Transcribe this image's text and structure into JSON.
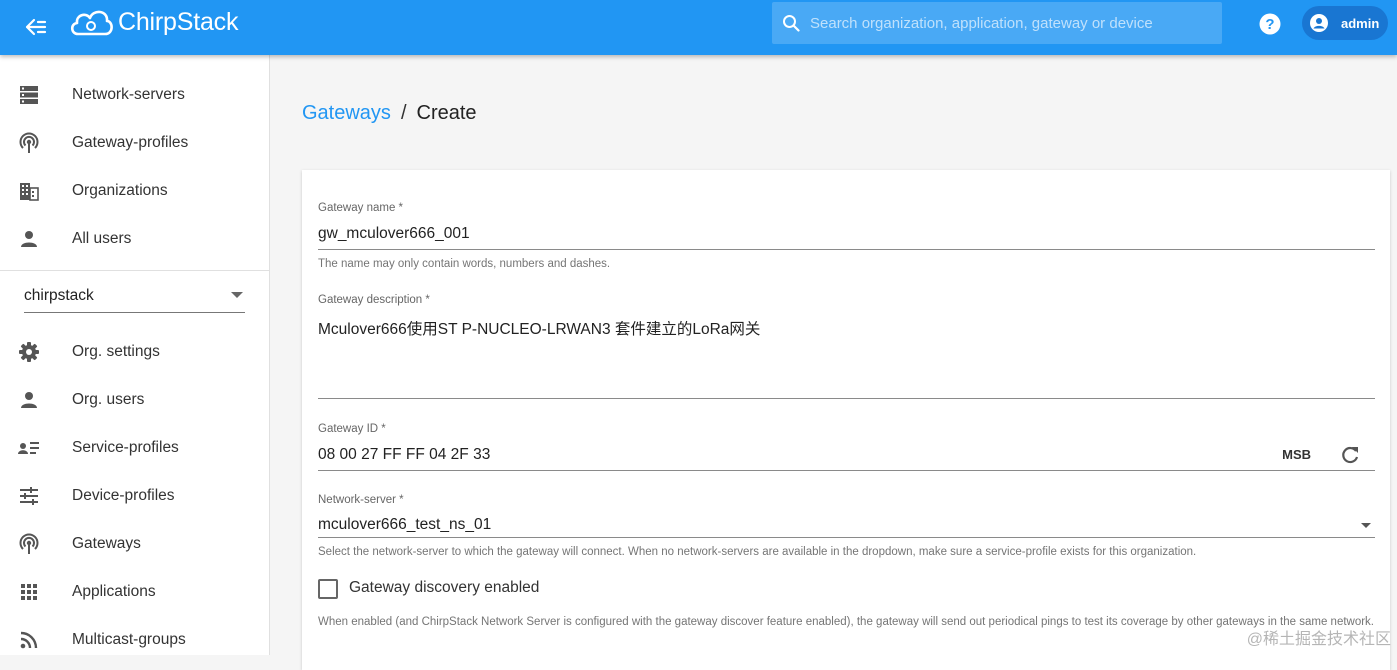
{
  "app": {
    "name": "ChirpStack",
    "search_placeholder": "Search organization, application, gateway or device",
    "user": "admin"
  },
  "sidebar": {
    "global_items": [
      {
        "label": "Network-servers",
        "icon": "server-icon"
      },
      {
        "label": "Gateway-profiles",
        "icon": "broadcast-icon"
      },
      {
        "label": "Organizations",
        "icon": "building-icon"
      },
      {
        "label": "All users",
        "icon": "person-icon"
      }
    ],
    "org_selector": {
      "value": "chirpstack"
    },
    "org_items": [
      {
        "label": "Org. settings",
        "icon": "gear-icon"
      },
      {
        "label": "Org. users",
        "icon": "person-icon"
      },
      {
        "label": "Service-profiles",
        "icon": "person-list-icon"
      },
      {
        "label": "Device-profiles",
        "icon": "sliders-icon"
      },
      {
        "label": "Gateways",
        "icon": "broadcast-icon"
      },
      {
        "label": "Applications",
        "icon": "apps-grid-icon"
      },
      {
        "label": "Multicast-groups",
        "icon": "rss-icon"
      }
    ]
  },
  "breadcrumb": {
    "parent": "Gateways",
    "separator": "/",
    "current": "Create"
  },
  "form": {
    "name": {
      "label": "Gateway name *",
      "value": "gw_mculover666_001",
      "helper": "The name may only contain words, numbers and dashes."
    },
    "description": {
      "label": "Gateway description *",
      "value": "Mculover666使用ST P-NUCLEO-LRWAN3 套件建立的LoRa网关"
    },
    "gateway_id": {
      "label": "Gateway ID *",
      "value": "08 00 27 FF FF 04 2F 33",
      "byte_order": "MSB"
    },
    "network_server": {
      "label": "Network-server *",
      "value": "mculover666_test_ns_01",
      "helper": "Select the network-server to which the gateway will connect. When no network-servers are available in the dropdown, make sure a service-profile exists for this organization."
    },
    "discovery": {
      "label": "Gateway discovery enabled",
      "checked": false,
      "helper": "When enabled (and ChirpStack Network Server is configured with the gateway discover feature enabled), the gateway will send out periodical pings to test its coverage by other gateways in the same network."
    }
  },
  "watermark": "@稀土掘金技术社区",
  "colors": {
    "primary": "#2196f3",
    "primary_dark": "#1976d2"
  }
}
